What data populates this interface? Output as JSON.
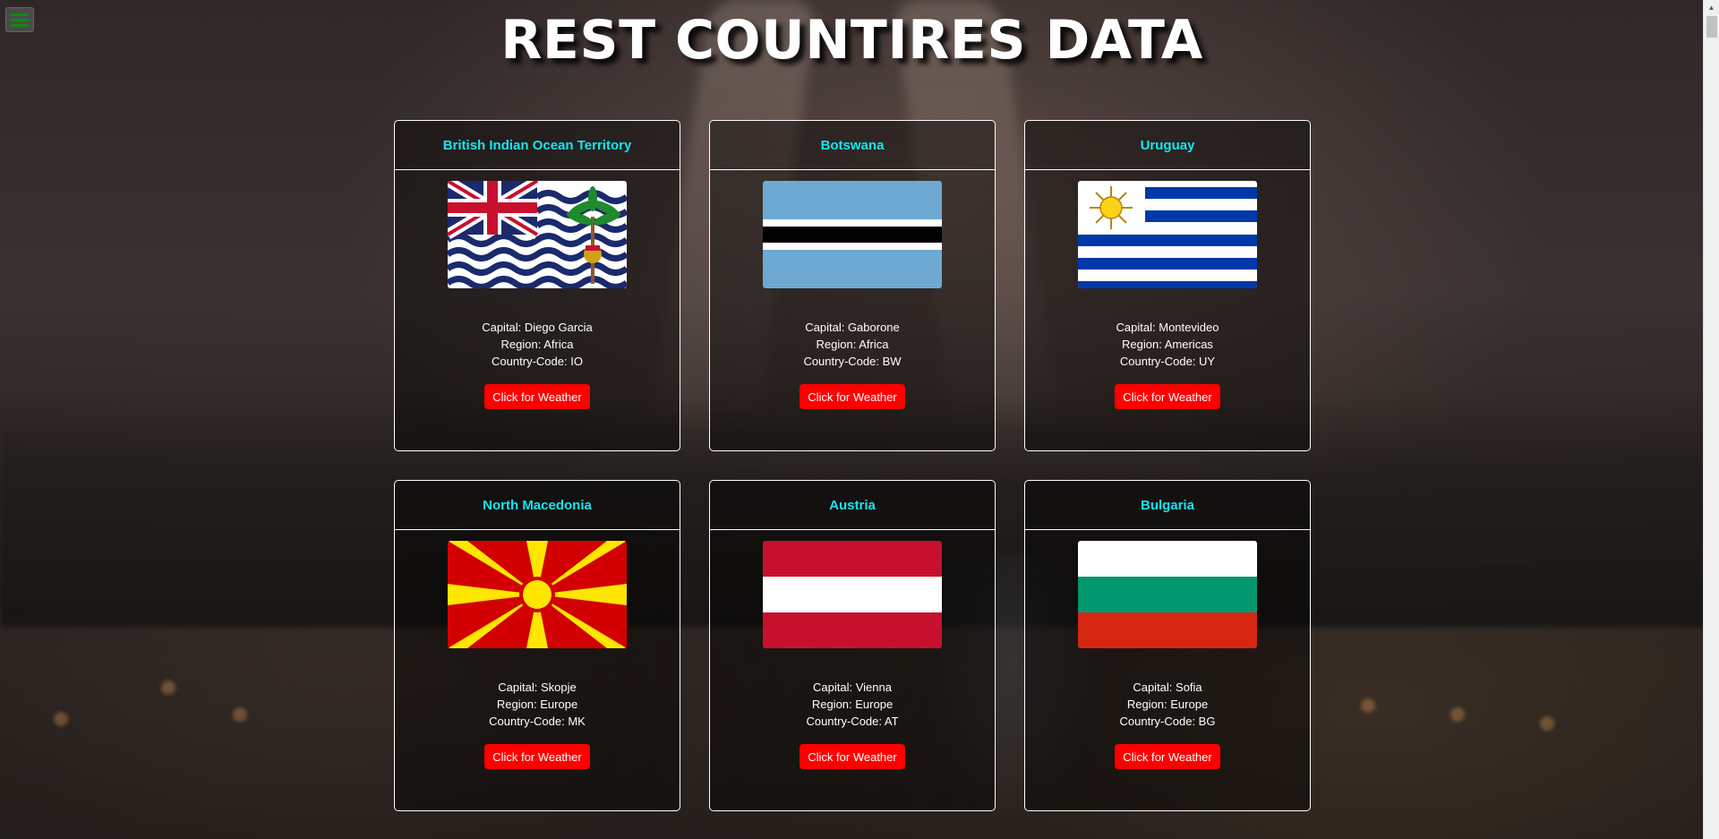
{
  "page": {
    "title": "REST COUNTIRES DATA"
  },
  "menu": {
    "icon": "hamburger-menu-icon"
  },
  "labels": {
    "capital": "Capital: ",
    "region": "Region: ",
    "code": "Country-Code: ",
    "button": "Click for Weather"
  },
  "colors": {
    "country_name": "#15e6f0",
    "button_bg": "#ff0000",
    "menu_bars": "#0f8a0f"
  },
  "countries": [
    {
      "name": "British Indian Ocean Territory",
      "capital": "Diego Garcia",
      "region": "Africa",
      "code": "IO",
      "flag": "british-indian-ocean-territory-flag"
    },
    {
      "name": "Botswana",
      "capital": "Gaborone",
      "region": "Africa",
      "code": "BW",
      "flag": "botswana-flag"
    },
    {
      "name": "Uruguay",
      "capital": "Montevideo",
      "region": "Americas",
      "code": "UY",
      "flag": "uruguay-flag"
    },
    {
      "name": "North Macedonia",
      "capital": "Skopje",
      "region": "Europe",
      "code": "MK",
      "flag": "north-macedonia-flag"
    },
    {
      "name": "Austria",
      "capital": "Vienna",
      "region": "Europe",
      "code": "AT",
      "flag": "austria-flag"
    },
    {
      "name": "Bulgaria",
      "capital": "Sofia",
      "region": "Europe",
      "code": "BG",
      "flag": "bulgaria-flag"
    }
  ]
}
